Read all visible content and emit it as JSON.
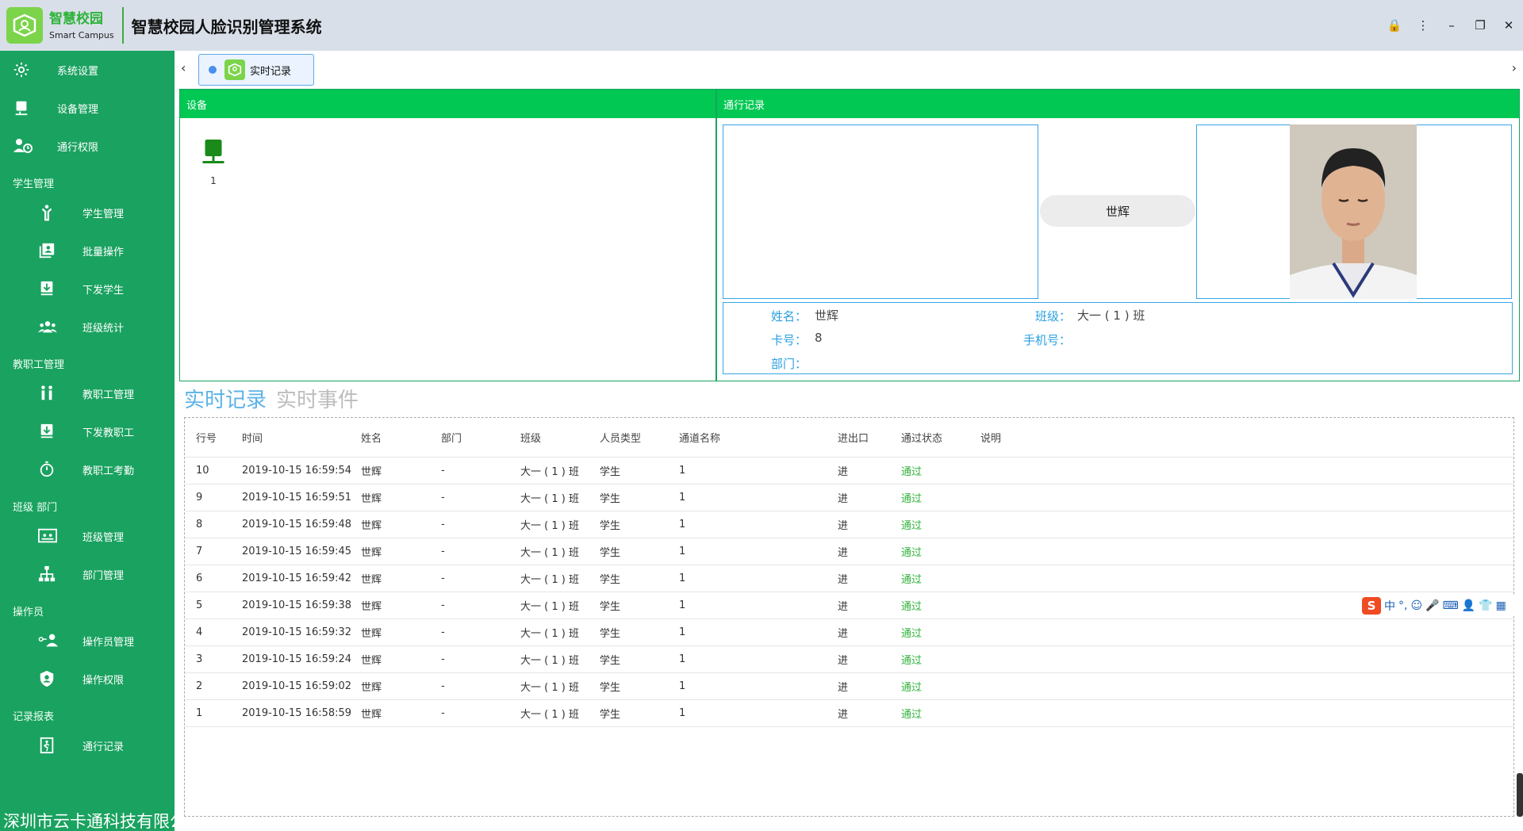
{
  "header": {
    "logo_cn": "智慧校园",
    "logo_en": "Smart Campus",
    "title": "智慧校园人脸识别管理系统",
    "controls": [
      "🔒",
      "⋮",
      "–",
      "❐",
      "✕"
    ]
  },
  "sidebar": {
    "top_items": [
      {
        "label": "系统设置",
        "icon": "gear-icon"
      },
      {
        "label": "设备管理",
        "icon": "monitor-icon"
      },
      {
        "label": "通行权限",
        "icon": "user-clock-icon"
      }
    ],
    "groups": [
      {
        "title": "学生管理",
        "items": [
          {
            "label": "学生管理",
            "icon": "student-icon"
          },
          {
            "label": "批量操作",
            "icon": "batch-icon"
          },
          {
            "label": "下发学生",
            "icon": "download-icon"
          },
          {
            "label": "班级统计",
            "icon": "group-icon"
          }
        ]
      },
      {
        "title": "教职工管理",
        "items": [
          {
            "label": "教职工管理",
            "icon": "staff-icon"
          },
          {
            "label": "下发教职工",
            "icon": "download-icon"
          },
          {
            "label": "教职工考勤",
            "icon": "stopwatch-icon"
          }
        ]
      },
      {
        "title": "班级 部门",
        "items": [
          {
            "label": "班级管理",
            "icon": "classroom-icon"
          },
          {
            "label": "部门管理",
            "icon": "org-chart-icon"
          }
        ]
      },
      {
        "title": "操作员",
        "items": [
          {
            "label": "操作员管理",
            "icon": "operator-icon"
          },
          {
            "label": "操作权限",
            "icon": "shield-icon"
          }
        ]
      },
      {
        "title": "记录报表",
        "items": [
          {
            "label": "通行记录",
            "icon": "door-exit-icon"
          }
        ]
      }
    ],
    "footer": "深圳市云卡通科技有限公司"
  },
  "tabbar": {
    "left_arrow": "‹",
    "right_arrow": "›",
    "tabs": [
      {
        "label": "实时记录"
      }
    ]
  },
  "device_panel": {
    "title": "设备",
    "devices": [
      {
        "num": "1"
      }
    ]
  },
  "record_panel": {
    "title": "通行记录",
    "name_pill": "世辉",
    "info": {
      "name_label": "姓名：",
      "name_value": "世辉",
      "class_label": "班级：",
      "class_value": "大一 ( 1 ) 班",
      "card_label": "卡号：",
      "card_value": "8",
      "phone_label": "手机号：",
      "phone_value": "",
      "dept_label": "部门：",
      "dept_value": ""
    }
  },
  "record_tabs": {
    "active": "实时记录",
    "inactive": "实时事件"
  },
  "table": {
    "columns": [
      "行号",
      "时间",
      "姓名",
      "部门",
      "班级",
      "人员类型",
      "通道名称",
      "进出口",
      "通过状态",
      "说明"
    ],
    "rows": [
      [
        "10",
        "2019-10-15 16:59:54",
        "世辉",
        "-",
        "大一 ( 1 ) 班",
        "学生",
        "1",
        "进",
        "通过",
        ""
      ],
      [
        "9",
        "2019-10-15 16:59:51",
        "世辉",
        "-",
        "大一 ( 1 ) 班",
        "学生",
        "1",
        "进",
        "通过",
        ""
      ],
      [
        "8",
        "2019-10-15 16:59:48",
        "世辉",
        "-",
        "大一 ( 1 ) 班",
        "学生",
        "1",
        "进",
        "通过",
        ""
      ],
      [
        "7",
        "2019-10-15 16:59:45",
        "世辉",
        "-",
        "大一 ( 1 ) 班",
        "学生",
        "1",
        "进",
        "通过",
        ""
      ],
      [
        "6",
        "2019-10-15 16:59:42",
        "世辉",
        "-",
        "大一 ( 1 ) 班",
        "学生",
        "1",
        "进",
        "通过",
        ""
      ],
      [
        "5",
        "2019-10-15 16:59:38",
        "世辉",
        "-",
        "大一 ( 1 ) 班",
        "学生",
        "1",
        "进",
        "通过",
        ""
      ],
      [
        "4",
        "2019-10-15 16:59:32",
        "世辉",
        "-",
        "大一 ( 1 ) 班",
        "学生",
        "1",
        "进",
        "通过",
        ""
      ],
      [
        "3",
        "2019-10-15 16:59:24",
        "世辉",
        "-",
        "大一 ( 1 ) 班",
        "学生",
        "1",
        "进",
        "通过",
        ""
      ],
      [
        "2",
        "2019-10-15 16:59:02",
        "世辉",
        "-",
        "大一 ( 1 ) 班",
        "学生",
        "1",
        "进",
        "通过",
        ""
      ],
      [
        "1",
        "2019-10-15 16:58:59",
        "世辉",
        "-",
        "大一 ( 1 ) 班",
        "学生",
        "1",
        "进",
        "通过",
        ""
      ]
    ]
  },
  "ime": {
    "logo": "S",
    "symbols": [
      "中",
      "°,",
      "☺",
      "🎤",
      "⌨",
      "👤",
      "👕",
      "▦"
    ]
  },
  "colors": {
    "sidebar": "#1aa260",
    "panel_header": "#00c853",
    "accent_blue": "#35a6e6",
    "pass_green": "#2fb33a"
  }
}
